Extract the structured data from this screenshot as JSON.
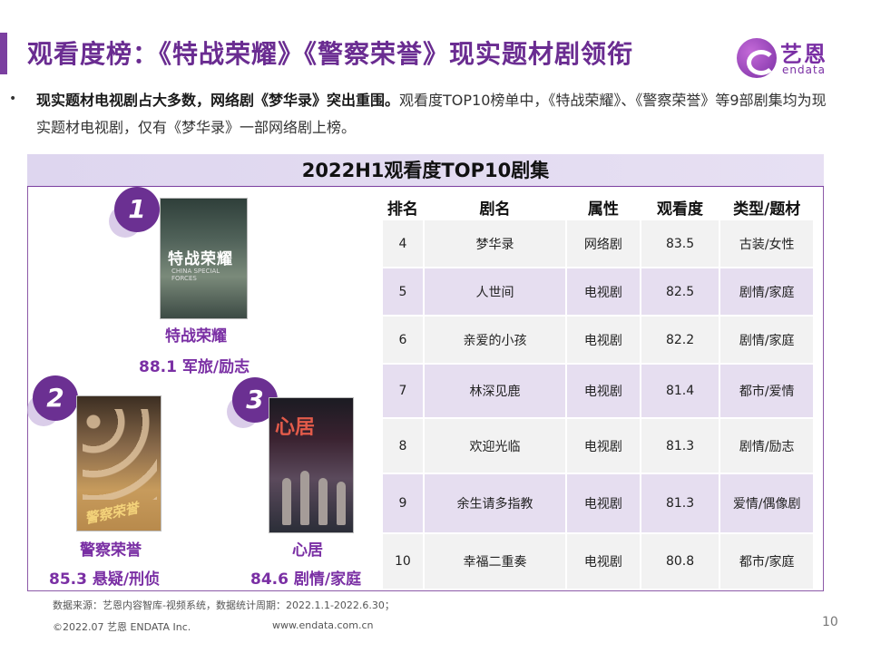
{
  "header": {
    "title": "观看度榜：《特战荣耀》《警察荣誉》现实题材剧领衔",
    "logo_cn": "艺恩",
    "logo_en": "endata"
  },
  "summary": {
    "bullet": "•",
    "bold_text": "现实题材电视剧占大多数，网络剧《梦华录》突出重围。",
    "text": "观看度TOP10榜单中，《特战荣耀》、《警察荣誉》等9部剧集均为现实题材电视剧，仅有《梦华录》一部网络剧上榜。"
  },
  "section_title": "2022H1观看度TOP10剧集",
  "top3": [
    {
      "rank": "1",
      "name": "特战荣耀",
      "score_line": "88.1  军旅/励志",
      "poster_title": "特战荣耀",
      "poster_sub": "CHINA SPECIAL FORCES"
    },
    {
      "rank": "2",
      "name": "警察荣誉",
      "score_line": "85.3   悬疑/刑侦",
      "poster_title": "警察荣誉"
    },
    {
      "rank": "3",
      "name": "心居",
      "score_line": "84.6 剧情/家庭",
      "poster_title": "心居"
    }
  ],
  "table": {
    "headers": [
      "排名",
      "剧名",
      "属性",
      "观看度",
      "类型/题材"
    ],
    "rows": [
      [
        "4",
        "梦华录",
        "网络剧",
        "83.5",
        "古装/女性"
      ],
      [
        "5",
        "人世间",
        "电视剧",
        "82.5",
        "剧情/家庭"
      ],
      [
        "6",
        "亲爱的小孩",
        "电视剧",
        "82.2",
        "剧情/家庭"
      ],
      [
        "7",
        "林深见鹿",
        "电视剧",
        "81.4",
        "都市/爱情"
      ],
      [
        "8",
        "欢迎光临",
        "电视剧",
        "81.3",
        "剧情/励志"
      ],
      [
        "9",
        "余生请多指教",
        "电视剧",
        "81.3",
        "爱情/偶像剧"
      ],
      [
        "10",
        "幸福二重奏",
        "电视剧",
        "80.8",
        "都市/家庭"
      ]
    ]
  },
  "footer": {
    "source": "数据来源：艺恩内容智库-视频系统，数据统计周期：2022.1.1-2022.6.30；",
    "copyright": "©2022.07 艺恩 ENDATA Inc.",
    "website": "www.endata.com.cn",
    "page": "10"
  },
  "colors": {
    "brand_purple": "#6a2c91",
    "row_light": "#f2f2f2",
    "row_purple": "#e6def0"
  }
}
